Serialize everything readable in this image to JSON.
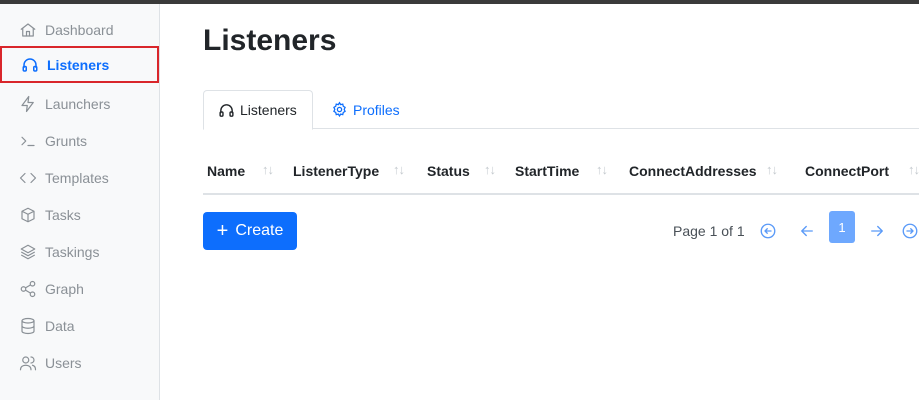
{
  "sidebar": {
    "items": [
      {
        "label": "Dashboard",
        "icon": "home-icon"
      },
      {
        "label": "Listeners",
        "icon": "headphones-icon"
      },
      {
        "label": "Launchers",
        "icon": "lightning-icon"
      },
      {
        "label": "Grunts",
        "icon": "terminal-icon"
      },
      {
        "label": "Templates",
        "icon": "code-icon"
      },
      {
        "label": "Tasks",
        "icon": "box-icon"
      },
      {
        "label": "Taskings",
        "icon": "layers-icon"
      },
      {
        "label": "Graph",
        "icon": "share-icon"
      },
      {
        "label": "Data",
        "icon": "database-icon"
      },
      {
        "label": "Users",
        "icon": "users-icon"
      }
    ],
    "active": "Listeners"
  },
  "main": {
    "title": "Listeners",
    "tabs": [
      {
        "label": "Listeners",
        "icon": "headphones-icon"
      },
      {
        "label": "Profiles",
        "icon": "gear-icon"
      }
    ],
    "table": {
      "columns": [
        "Name",
        "ListenerType",
        "Status",
        "StartTime",
        "ConnectAddresses",
        "ConnectPort"
      ],
      "sort_glyph": "↑↓"
    },
    "create_label": "Create",
    "pagination": {
      "text": "Page 1 of 1",
      "current": "1"
    }
  },
  "colors": {
    "primary": "#0d6efd",
    "sidebar_bg": "#f8f9fa",
    "highlight_border": "#d9262b",
    "muted": "#8a9096"
  }
}
